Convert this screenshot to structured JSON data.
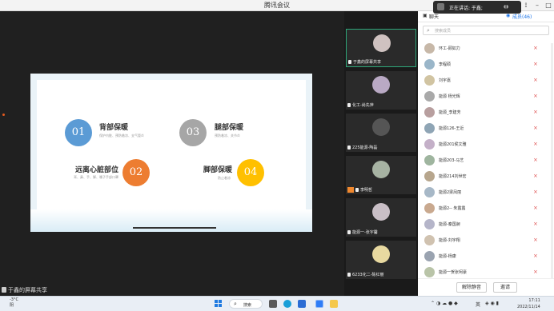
{
  "window": {
    "title": "腾讯会议"
  },
  "toast": {
    "text": "正在讲话: 于鑫;"
  },
  "stage": {
    "share_label": "于鑫的屏幕共享",
    "slide": {
      "items": [
        {
          "num": "01",
          "title": "背部保暖",
          "sub": "保护内脏、预防着凉、支气管炎",
          "color": "#5b9bd5"
        },
        {
          "num": "03",
          "title": "腿部保暖",
          "sub": "预防着凉、关节炎",
          "color": "#a6a6a6"
        },
        {
          "num": "02",
          "title": "远离心脏部位",
          "sub": "耳、鼻、手、脚、嗓子手部口罩",
          "color": "#ed7d31"
        },
        {
          "num": "04",
          "title": "脚部保暖",
          "sub": "防止着凉",
          "color": "#ffc000"
        }
      ]
    }
  },
  "videos": [
    {
      "label": "于鑫的屏幕共享",
      "active": true
    },
    {
      "label": "化工-尚先萍",
      "active": false
    },
    {
      "label": "225能源-陶磊",
      "active": false
    },
    {
      "label": "李明哲",
      "active": false,
      "camera_off": true
    },
    {
      "label": "能源一-张宇馨",
      "active": false
    },
    {
      "label": "6233化二-陈红丽",
      "active": false
    }
  ],
  "panel": {
    "tab_chat": "聊天",
    "tab_members": "成员(46)",
    "search_placeholder": "搜索成员",
    "members": [
      "环工-顾如力",
      "李程硕",
      "刘宇嘉",
      "能源 杨光辉",
      "能源_李建芳",
      "能源126-王近",
      "能源201侯文雅",
      "能源203-马艺",
      "能源214刘世宏",
      "能源2梁凤丽",
      "能源2-- 朱露露",
      "能源-秦国昶",
      "能源-刘宇翔",
      "能源-杨康",
      "能源一贺张柯豪"
    ],
    "mute_all": "解除静音",
    "invite": "邀请"
  },
  "taskbar": {
    "temp": "-3°C",
    "weather": "阴",
    "search": "搜索",
    "ime": "英",
    "time": "17:11",
    "date": "2022/11/14"
  }
}
